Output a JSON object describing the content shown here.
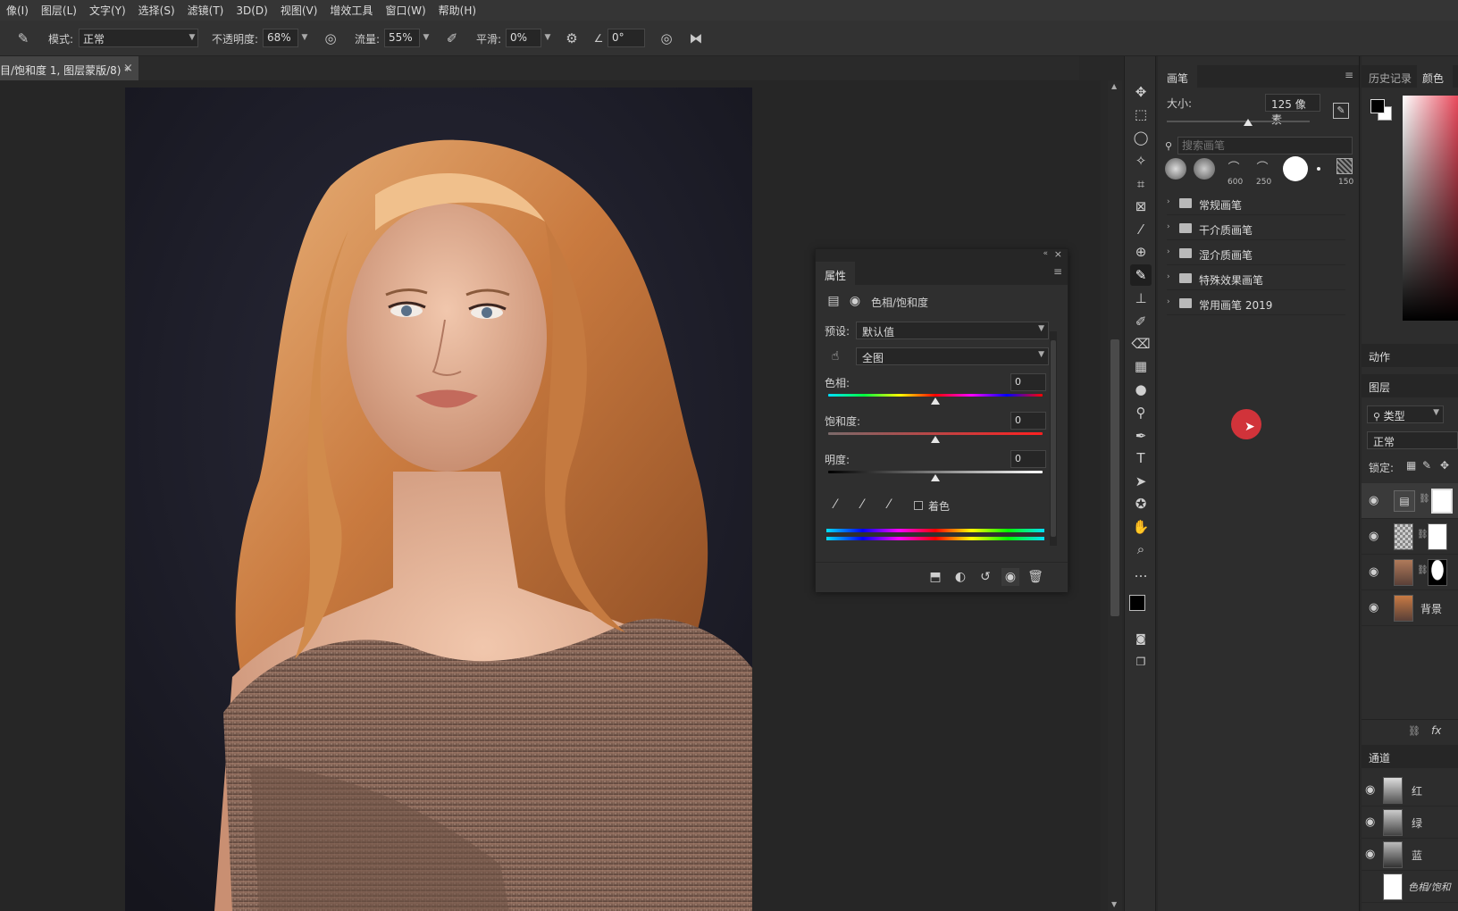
{
  "menubar": {
    "items": [
      "像(I)",
      "图层(L)",
      "文字(Y)",
      "选择(S)",
      "滤镜(T)",
      "3D(D)",
      "视图(V)",
      "增效工具",
      "窗口(W)",
      "帮助(H)"
    ]
  },
  "options": {
    "mode_label": "模式:",
    "mode_value": "正常",
    "opacity_label": "不透明度:",
    "opacity_value": "68%",
    "flow_label": "流量:",
    "flow_value": "55%",
    "smooth_label": "平滑:",
    "smooth_value": "0%",
    "angle_value": "0°"
  },
  "document_tab": {
    "title": "目/饱和度 1, 图层蒙版/8) *",
    "close": "×"
  },
  "brush_panel": {
    "tab": "画笔",
    "size_label": "大小:",
    "size_value": "125 像素",
    "search_placeholder": "搜索画笔",
    "preset_sizes": [
      "600",
      "250",
      "150"
    ],
    "folders": [
      "常规画笔",
      "干介质画笔",
      "湿介质画笔",
      "特殊效果画笔",
      "常用画笔 2019"
    ]
  },
  "right_column": {
    "tabs": [
      "历史记录",
      "颜色"
    ],
    "actions_title": "动作",
    "layers_title": "图层",
    "filter_label": "类型",
    "blend_mode": "正常",
    "lock_label": "锁定:",
    "layers": [
      {
        "name": "",
        "visible": true,
        "kind": "adjustment"
      },
      {
        "name": "",
        "visible": true,
        "kind": "masked-transparent"
      },
      {
        "name": "",
        "visible": true,
        "kind": "masked-photo"
      },
      {
        "name": "背景",
        "visible": true,
        "kind": "photo"
      }
    ],
    "channels_title": "通道",
    "channels": [
      {
        "name": "红"
      },
      {
        "name": "绿"
      },
      {
        "name": "蓝"
      },
      {
        "name": "色相/饱和"
      }
    ],
    "fx_label": "fx"
  },
  "properties": {
    "tab": "属性",
    "title": "色相/饱和度",
    "preset_label": "预设:",
    "preset_value": "默认值",
    "range_value": "全图",
    "hue_label": "色相:",
    "hue_value": "0",
    "saturation_label": "饱和度:",
    "saturation_value": "0",
    "lightness_label": "明度:",
    "lightness_value": "0",
    "colorize_label": "着色",
    "colorize_checked": false
  },
  "colors": {
    "accent_cursor": "#e0343c",
    "panel_bg": "#2d2d2d",
    "menu_bg": "#353535"
  }
}
